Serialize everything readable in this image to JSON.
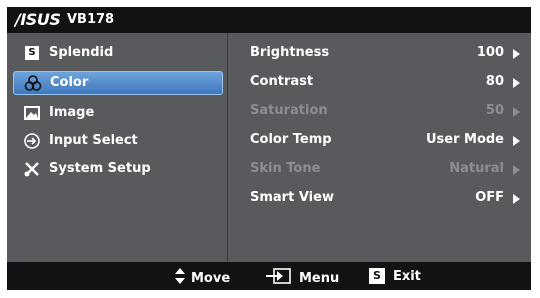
{
  "header": {
    "brand": "/ISUS",
    "model": "VB178"
  },
  "sidebar": {
    "items": [
      {
        "label": "Splendid",
        "icon": "splendid-s-icon",
        "active": false
      },
      {
        "label": "Color",
        "icon": "color-palette-icon",
        "active": true
      },
      {
        "label": "Image",
        "icon": "image-icon",
        "active": false
      },
      {
        "label": "Input Select",
        "icon": "input-select-icon",
        "active": false
      },
      {
        "label": "System Setup",
        "icon": "tools-icon",
        "active": false
      }
    ]
  },
  "settings": [
    {
      "label": "Brightness",
      "value": "100",
      "enabled": true
    },
    {
      "label": "Contrast",
      "value": "80",
      "enabled": true
    },
    {
      "label": "Saturation",
      "value": "50",
      "enabled": false
    },
    {
      "label": "Color Temp",
      "value": "User Mode",
      "enabled": true
    },
    {
      "label": "Skin Tone",
      "value": "Natural",
      "enabled": false
    },
    {
      "label": "Smart View",
      "value": "OFF",
      "enabled": true
    }
  ],
  "footer": {
    "move_label": "Move",
    "menu_label": "Menu",
    "exit_label": "Exit",
    "exit_key": "S"
  },
  "colors": {
    "active_accent": "#4a86c8",
    "panel": "#5a5b5e",
    "bar": "#111214",
    "disabled_text": "#8d8e92"
  }
}
